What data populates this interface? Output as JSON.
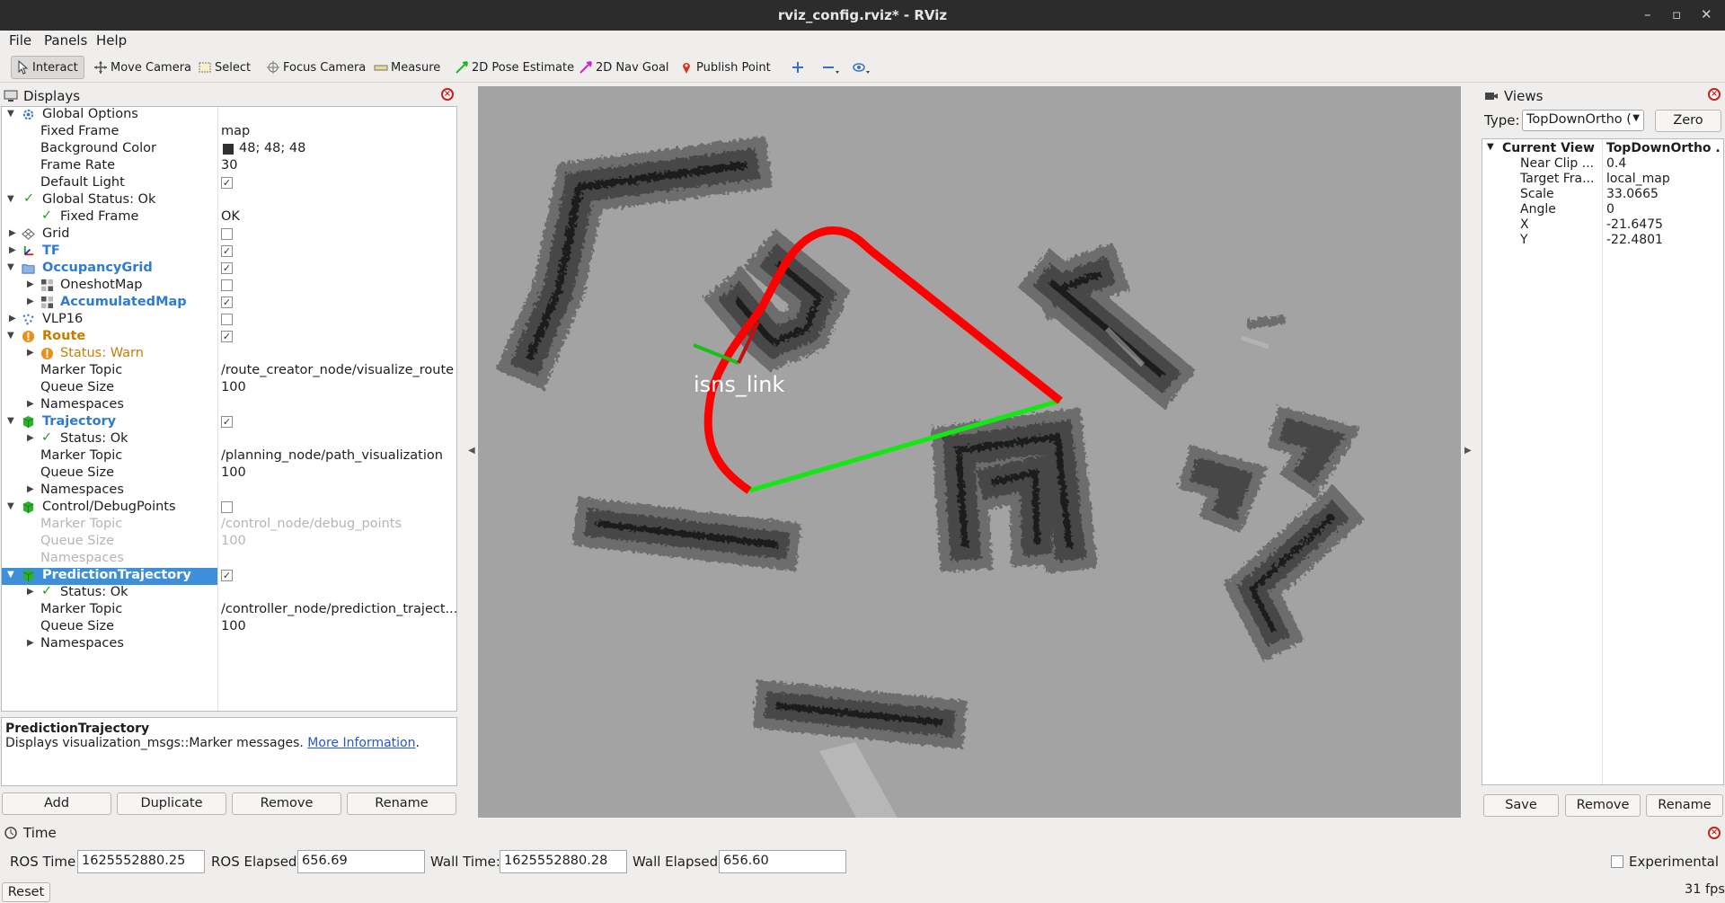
{
  "window": {
    "title": "rviz_config.rviz* - RViz",
    "controls": [
      "–",
      "▫",
      "✕"
    ]
  },
  "menu": {
    "file": "File",
    "panels": "Panels",
    "help": "Help"
  },
  "toolbar": {
    "tools": [
      {
        "label": "Interact",
        "icon": "cursor-icon",
        "active": true
      },
      {
        "label": "Move Camera",
        "icon": "move-icon"
      },
      {
        "label": "Select",
        "icon": "select-icon"
      },
      {
        "label": "Focus Camera",
        "icon": "focus-icon"
      },
      {
        "label": "Measure",
        "icon": "ruler-icon"
      },
      {
        "label": "2D Pose Estimate",
        "icon": "pose-arrow-icon"
      },
      {
        "label": "2D Nav Goal",
        "icon": "goal-arrow-icon"
      },
      {
        "label": "Publish Point",
        "icon": "pin-icon"
      }
    ]
  },
  "displays": {
    "title": "Displays",
    "rows": [
      {
        "label": "Global Options",
        "value": ""
      },
      {
        "label": "Fixed Frame",
        "value": "map"
      },
      {
        "label": "Background Color",
        "value": "48; 48; 48"
      },
      {
        "label": "Frame Rate",
        "value": "30"
      },
      {
        "label": "Default Light",
        "value": ""
      },
      {
        "label": "Global Status: Ok",
        "value": ""
      },
      {
        "label": "Fixed Frame",
        "value": "OK"
      },
      {
        "label": "Grid",
        "value": ""
      },
      {
        "label": "TF",
        "value": ""
      },
      {
        "label": "OccupancyGrid",
        "value": ""
      },
      {
        "label": "OneshotMap",
        "value": ""
      },
      {
        "label": "AccumulatedMap",
        "value": ""
      },
      {
        "label": "VLP16",
        "value": ""
      },
      {
        "label": "Route",
        "value": ""
      },
      {
        "label": "Status: Warn",
        "value": ""
      },
      {
        "label": "Marker Topic",
        "value": "/route_creator_node/visualize_route"
      },
      {
        "label": "Queue Size",
        "value": "100"
      },
      {
        "label": "Namespaces",
        "value": ""
      },
      {
        "label": "Trajectory",
        "value": ""
      },
      {
        "label": "Status: Ok",
        "value": ""
      },
      {
        "label": "Marker Topic",
        "value": "/planning_node/path_visualization"
      },
      {
        "label": "Queue Size",
        "value": "100"
      },
      {
        "label": "Namespaces",
        "value": ""
      },
      {
        "label": "Control/DebugPoints",
        "value": ""
      },
      {
        "label": "Marker Topic",
        "value": "/control_node/debug_points"
      },
      {
        "label": "Queue Size",
        "value": "100"
      },
      {
        "label": "Namespaces",
        "value": ""
      },
      {
        "label": "PredictionTrajectory",
        "value": ""
      },
      {
        "label": "Status: Ok",
        "value": ""
      },
      {
        "label": "Marker Topic",
        "value": "/controller_node/prediction_traject..."
      },
      {
        "label": "Queue Size",
        "value": "100"
      },
      {
        "label": "Namespaces",
        "value": ""
      }
    ],
    "description": {
      "title": "PredictionTrajectory",
      "text": "Displays visualization_msgs::Marker messages. ",
      "link": "More Information",
      "end": "."
    },
    "buttons": {
      "add": "Add",
      "duplicate": "Duplicate",
      "remove": "Remove",
      "rename": "Rename"
    }
  },
  "viewport": {
    "frame_label": "isns_link"
  },
  "views": {
    "title": "Views",
    "type_label": "Type:",
    "type_value": "TopDownOrtho (",
    "zero": "Zero",
    "rows": [
      {
        "label": "Current View",
        "value": "TopDownOrtho ..."
      },
      {
        "label": "Near Clip ...",
        "value": "0.4"
      },
      {
        "label": "Target Fra...",
        "value": "local_map"
      },
      {
        "label": "Scale",
        "value": "33.0665"
      },
      {
        "label": "Angle",
        "value": "0"
      },
      {
        "label": "X",
        "value": "-21.6475"
      },
      {
        "label": "Y",
        "value": "-22.4801"
      }
    ],
    "buttons": {
      "save": "Save",
      "remove": "Remove",
      "rename": "Rename"
    }
  },
  "time": {
    "title": "Time",
    "ros_time_label": "ROS Time:",
    "ros_time": "1625552880.25",
    "ros_elapsed_label": "ROS Elapsed:",
    "ros_elapsed": "656.69",
    "wall_time_label": "Wall Time:",
    "wall_time": "1625552880.28",
    "wall_elapsed_label": "Wall Elapsed:",
    "wall_elapsed": "656.60",
    "experimental": "Experimental",
    "reset": "Reset",
    "fps": "31 fps"
  },
  "colors": {
    "selection": "#3c8fd8",
    "display_name": "#2f7bd0",
    "warn": "#c87b00",
    "route": "#ff0000",
    "trajectory": "#00ee00"
  }
}
